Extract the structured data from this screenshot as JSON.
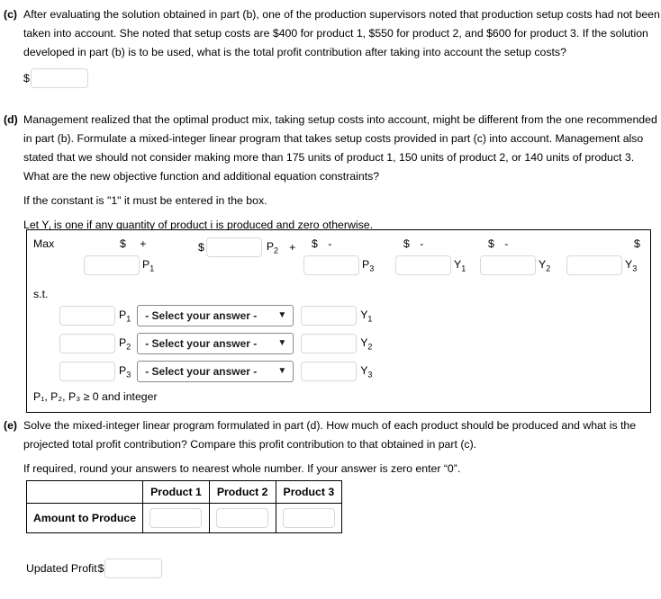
{
  "part_c": {
    "label": "(c)",
    "text": "After evaluating the solution obtained in part (b), one of the production supervisors noted that production setup costs had not been taken into account. She noted that setup costs are $400 for product 1, $550 for product 2, and $600 for product 3. If the solution developed in part (b) is to be used, what is the total profit contribution after taking into account the setup costs?",
    "currency": "$",
    "answer_value": "",
    "answer_placeholder": ""
  },
  "part_d": {
    "label": "(d)",
    "text": "Management realized that the optimal product mix, taking setup costs into account, might be different from the one recommended in part (b). Formulate a mixed-integer linear program that takes setup costs provided in part (c) into account. Management also stated that we should not consider making more than 175 units of product 1, 150 units of product 2, or 140 units of product 3. What are the new objective function and additional equation constraints?",
    "note1": "If the constant is \"1\" it must be entered in the box.",
    "note2_pre": "Let Y",
    "note2_sub": "i",
    "note2_post": " is one if any quantity of product i is produced and zero otherwise."
  },
  "formulation": {
    "max_label": "Max",
    "st_label": "s.t.",
    "objective_terms": [
      {
        "prefix": "$",
        "operator": "",
        "value": "",
        "var": "P",
        "sub": "1",
        "trailing": "+"
      },
      {
        "prefix": "$",
        "operator": "",
        "value": "",
        "var": "P",
        "sub": "2",
        "trailing": "+"
      },
      {
        "prefix": "$",
        "operator": "-",
        "value": "",
        "var": "P",
        "sub": "3",
        "trailing": ""
      },
      {
        "prefix": "$",
        "operator": "-",
        "value": "",
        "var": "Y",
        "sub": "1",
        "trailing": ""
      },
      {
        "prefix": "$",
        "operator": "-",
        "value": "",
        "var": "Y",
        "sub": "2",
        "trailing": ""
      },
      {
        "prefix": "$",
        "operator": "",
        "value": "",
        "var": "Y",
        "sub": "3",
        "trailing": ""
      }
    ],
    "constraint_rows": [
      {
        "coef_value": "",
        "var": "P",
        "sub": "1",
        "select_label": "- Select your answer -",
        "rhs_value": "",
        "rhs_var": "Y",
        "rhs_sub": "1"
      },
      {
        "coef_value": "",
        "var": "P",
        "sub": "2",
        "select_label": "- Select your answer -",
        "rhs_value": "",
        "rhs_var": "Y",
        "rhs_sub": "2"
      },
      {
        "coef_value": "",
        "var": "P",
        "sub": "3",
        "select_label": "- Select your answer -",
        "rhs_value": "",
        "rhs_var": "Y",
        "rhs_sub": "3"
      }
    ],
    "select_caret": "⌄",
    "integer_line_pre": "P",
    "integer_line": "P₁, P₂, P₃ ≥ 0 and integer"
  },
  "part_e": {
    "label": "(e)",
    "text": "Solve the mixed-integer linear program formulated in part (d). How much of each product should be produced and what is the projected total profit contribution? Compare this profit contribution to that obtained in part (c).",
    "note": "If required, round your answers to nearest whole number. If your answer is zero enter “0”."
  },
  "result_table": {
    "corner_label": "",
    "headers": [
      "Product 1",
      "Product 2",
      "Product 3"
    ],
    "row_label": "Amount to Produce",
    "row_values": [
      "",
      "",
      ""
    ]
  },
  "updated_profit": {
    "label": "Updated Profit",
    "currency": "$",
    "value": ""
  },
  "colors": {
    "text": "#000000",
    "input_border": "#d8d8d8",
    "select_border": "#8a8a8a",
    "table_border": "#000000",
    "background": "#ffffff"
  }
}
